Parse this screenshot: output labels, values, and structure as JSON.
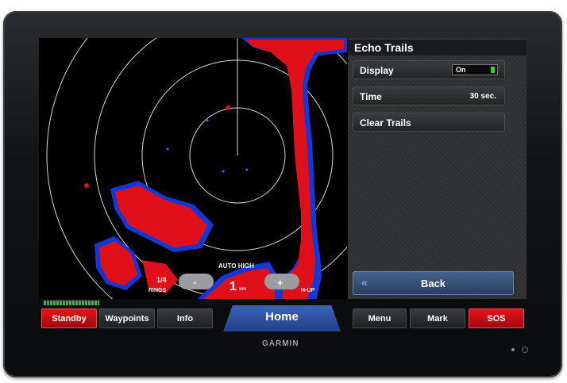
{
  "panel": {
    "title": "Echo Trails",
    "display_label": "Display",
    "display_value": "On",
    "time_label": "Time",
    "time_value": "30 sec.",
    "clear_label": "Clear Trails",
    "back_label": "Back",
    "back_chevron": "«"
  },
  "radar": {
    "gain_text": "AUTO HIGH",
    "range_top": "1/4",
    "range_bottom": "RINGS",
    "zoom_out": "-",
    "zoom_in": "+",
    "range_value": "1",
    "range_unit": "nm",
    "orientation": "H-UP"
  },
  "bottom": {
    "standby": "Standby",
    "waypoints": "Waypoints",
    "info": "Info",
    "home": "Home",
    "menu": "Menu",
    "mark": "Mark",
    "sos": "SOS"
  },
  "device": {
    "brand": "GARMIN"
  },
  "colors": {
    "echo": "#e0101a",
    "echo_edge": "#1840e0",
    "accent_blue": "#2a4d9c",
    "sos_red": "#d8101a",
    "led_green": "#3ecb3e"
  }
}
